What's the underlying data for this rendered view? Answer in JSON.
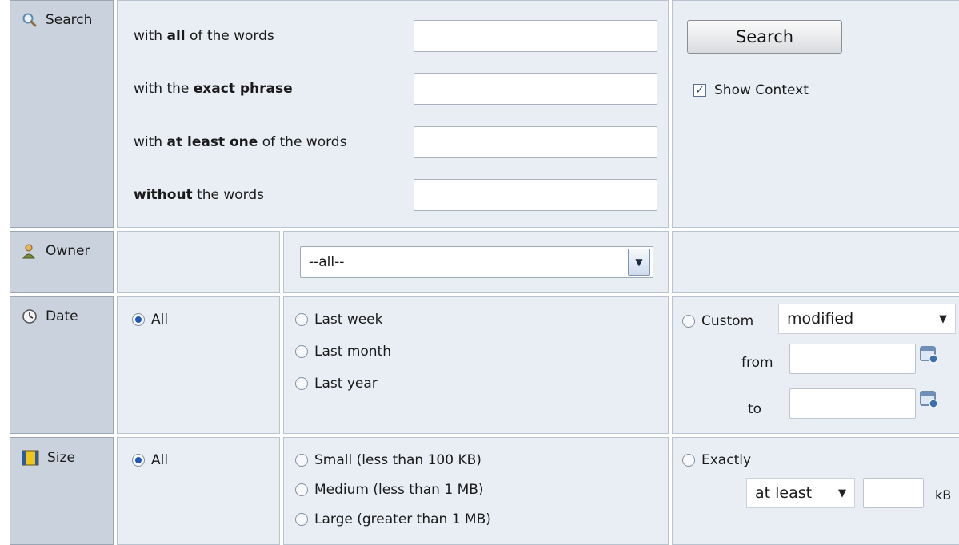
{
  "search": {
    "label": "Search",
    "rows": [
      {
        "pre": "with ",
        "bold": "all",
        "post": " of the words",
        "value": ""
      },
      {
        "pre": "with the ",
        "bold": "exact phrase",
        "post": "",
        "value": ""
      },
      {
        "pre": "with ",
        "bold": "at least one",
        "post": " of the words",
        "value": ""
      },
      {
        "pre": "",
        "bold": "without",
        "post": " the words",
        "value": ""
      }
    ],
    "button": "Search",
    "show_context": {
      "label": "Show Context",
      "checked": true
    }
  },
  "owner": {
    "label": "Owner",
    "selected": "--all--"
  },
  "date": {
    "label": "Date",
    "all": "All",
    "options": [
      "Last week",
      "Last month",
      "Last year"
    ],
    "custom": "Custom",
    "custom_field": "modified",
    "from": "from",
    "to": "to"
  },
  "size": {
    "label": "Size",
    "all": "All",
    "options": [
      "Small (less than 100 KB)",
      "Medium (less than 1 MB)",
      "Large (greater than 1 MB)"
    ],
    "exactly": "Exactly",
    "comparator": "at least",
    "unit": "kB"
  },
  "colors": {
    "panel": "#e9eef4",
    "label": "#c9d2dd",
    "accent": "#1f58b5"
  }
}
